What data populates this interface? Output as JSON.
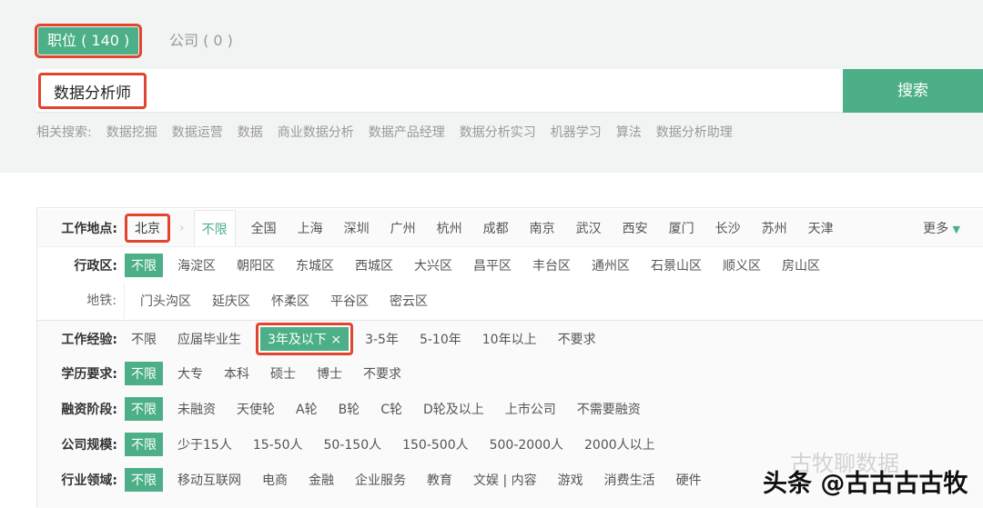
{
  "tabs": {
    "jobs": "职位 ( 140 )",
    "companies": "公司 ( 0 )"
  },
  "search": {
    "value": "数据分析师",
    "button": "搜索"
  },
  "related": {
    "label": "相关搜索:",
    "items": [
      "数据挖掘",
      "数据运营",
      "数据",
      "商业数据分析",
      "数据产品经理",
      "数据分析实习",
      "机器学习",
      "算法",
      "数据分析助理"
    ]
  },
  "location": {
    "label": "工作地点:",
    "city": "北京",
    "unlimited": "不限",
    "cities": [
      "全国",
      "上海",
      "深圳",
      "广州",
      "杭州",
      "成都",
      "南京",
      "武汉",
      "西安",
      "厦门",
      "长沙",
      "苏州",
      "天津"
    ],
    "more": "更多"
  },
  "district": {
    "label": "行政区:",
    "items": [
      "不限",
      "海淀区",
      "朝阳区",
      "东城区",
      "西城区",
      "大兴区",
      "昌平区",
      "丰台区",
      "通州区",
      "石景山区",
      "顺义区",
      "房山区"
    ]
  },
  "subway": {
    "label": "地铁:",
    "items": [
      "门头沟区",
      "延庆区",
      "怀柔区",
      "平谷区",
      "密云区"
    ]
  },
  "experience": {
    "label": "工作经验:",
    "items": [
      "不限",
      "应届毕业生"
    ],
    "selected": "3年及以下 ×",
    "rest": [
      "3-5年",
      "5-10年",
      "10年以上",
      "不要求"
    ]
  },
  "education": {
    "label": "学历要求:",
    "items": [
      "不限",
      "大专",
      "本科",
      "硕士",
      "博士",
      "不要求"
    ]
  },
  "funding": {
    "label": "融资阶段:",
    "items": [
      "不限",
      "未融资",
      "天使轮",
      "A轮",
      "B轮",
      "C轮",
      "D轮及以上",
      "上市公司",
      "不需要融资"
    ]
  },
  "size": {
    "label": "公司规模:",
    "items": [
      "不限",
      "少于15人",
      "15-50人",
      "50-150人",
      "150-500人",
      "500-2000人",
      "2000人以上"
    ]
  },
  "industry": {
    "label": "行业领域:",
    "items": [
      "不限",
      "移动互联网",
      "电商",
      "金融",
      "企业服务",
      "教育",
      "文娱 | 内容",
      "游戏",
      "消费生活",
      "硬件"
    ]
  },
  "watermark": {
    "wechat": "古牧聊数据",
    "toutiao": "头条 @古古古古牧"
  }
}
